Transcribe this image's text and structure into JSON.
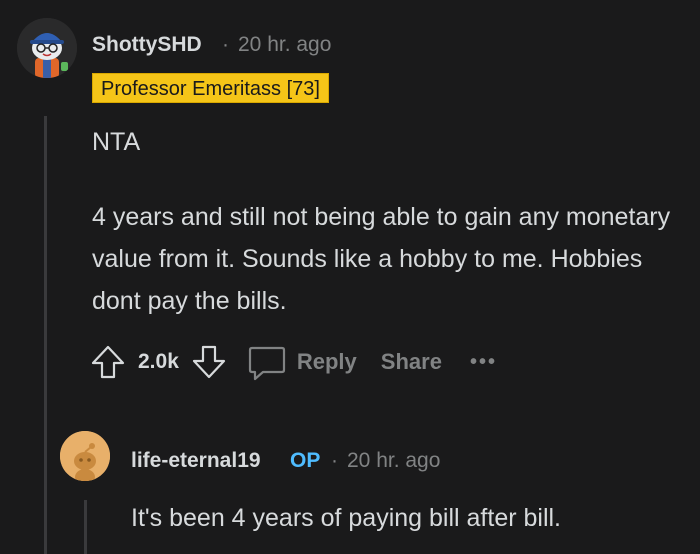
{
  "comment": {
    "username": "ShottySHD",
    "separator": "·",
    "timestamp": "20 hr. ago",
    "flair": "Professor Emeritass [73]",
    "paragraphs": [
      "NTA",
      "4 years and still not being able to gain any monetary value from it. Sounds like a hobby to me. Hobbies dont pay the bills."
    ],
    "score": "2.0k",
    "actions": {
      "reply": "Reply",
      "share": "Share",
      "more": "•••"
    }
  },
  "reply": {
    "username": "life-eternal19",
    "op_badge": "OP",
    "separator": "·",
    "timestamp": "20 hr. ago",
    "text": "It's been 4 years of paying bill after bill."
  },
  "colors": {
    "background": "#1a1a1b",
    "text": "#d7dadc",
    "muted": "#818384",
    "flair_bg": "#f5c518",
    "op_badge": "#4fbcff"
  }
}
